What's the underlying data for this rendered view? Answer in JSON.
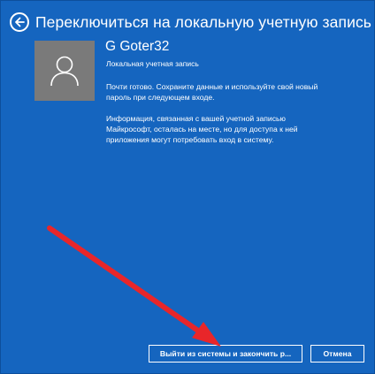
{
  "header": {
    "title": "Переключиться на локальную учетную запись",
    "back_icon": "back-arrow-icon"
  },
  "user": {
    "name": "G Goter32",
    "account_type": "Локальная учетная запись",
    "avatar_icon": "user-silhouette-icon"
  },
  "messages": {
    "ready_lines": [
      "Почти готово. Сохраните данные и используйте свой новый",
      "пароль при следующем входе."
    ],
    "info_lines": [
      "Информация, связанная с вашей учетной записью",
      "Майкрософт, осталась на месте, но для доступа к ней",
      "приложения могут потребовать вход в систему."
    ]
  },
  "buttons": {
    "signout_label": "Выйти из системы и закончить р...",
    "cancel_label": "Отмена"
  },
  "colors": {
    "background": "#1565bf",
    "avatar": "#7a7a7a",
    "text": "#ffffff",
    "annotation_arrow": "#e8262a"
  }
}
